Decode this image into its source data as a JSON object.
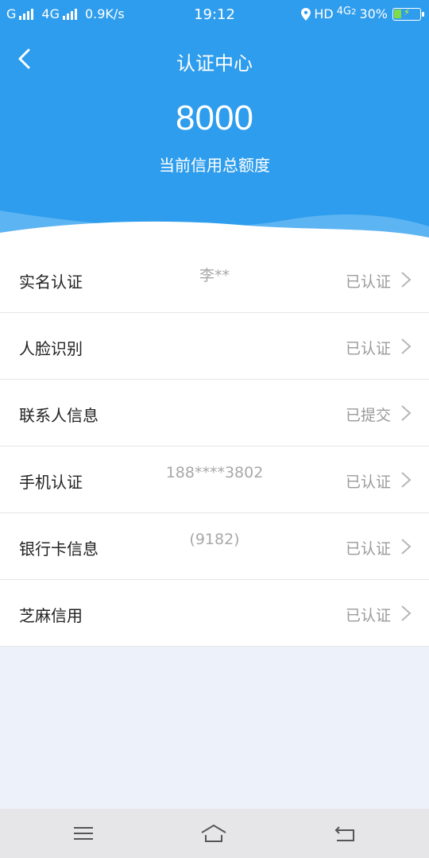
{
  "status_bar": {
    "carrier1": "G",
    "carrier2": "4G",
    "speed": "0.9K/s",
    "time": "19:12",
    "hd": "HD",
    "net": "4G",
    "net_sub": "2",
    "battery": "30%",
    "battery_level": 0.3
  },
  "header": {
    "title": "认证中心",
    "amount": "8000",
    "amount_label": "当前信用总额度"
  },
  "items": [
    {
      "label": "实名认证",
      "value": "李**",
      "status": "已认证"
    },
    {
      "label": "人脸识别",
      "value": "",
      "status": "已认证"
    },
    {
      "label": "联系人信息",
      "value": "",
      "status": "已提交"
    },
    {
      "label": "手机认证",
      "value": "188****3802",
      "status": "已认证"
    },
    {
      "label": "银行卡信息",
      "value": "(9182)",
      "status": "已认证"
    },
    {
      "label": "芝麻信用",
      "value": "",
      "status": "已认证"
    }
  ],
  "nav": {
    "icons": [
      "menu-icon",
      "home-icon",
      "back-icon"
    ]
  },
  "colors": {
    "primary": "#2f9ded",
    "background": "#edf2fa"
  }
}
